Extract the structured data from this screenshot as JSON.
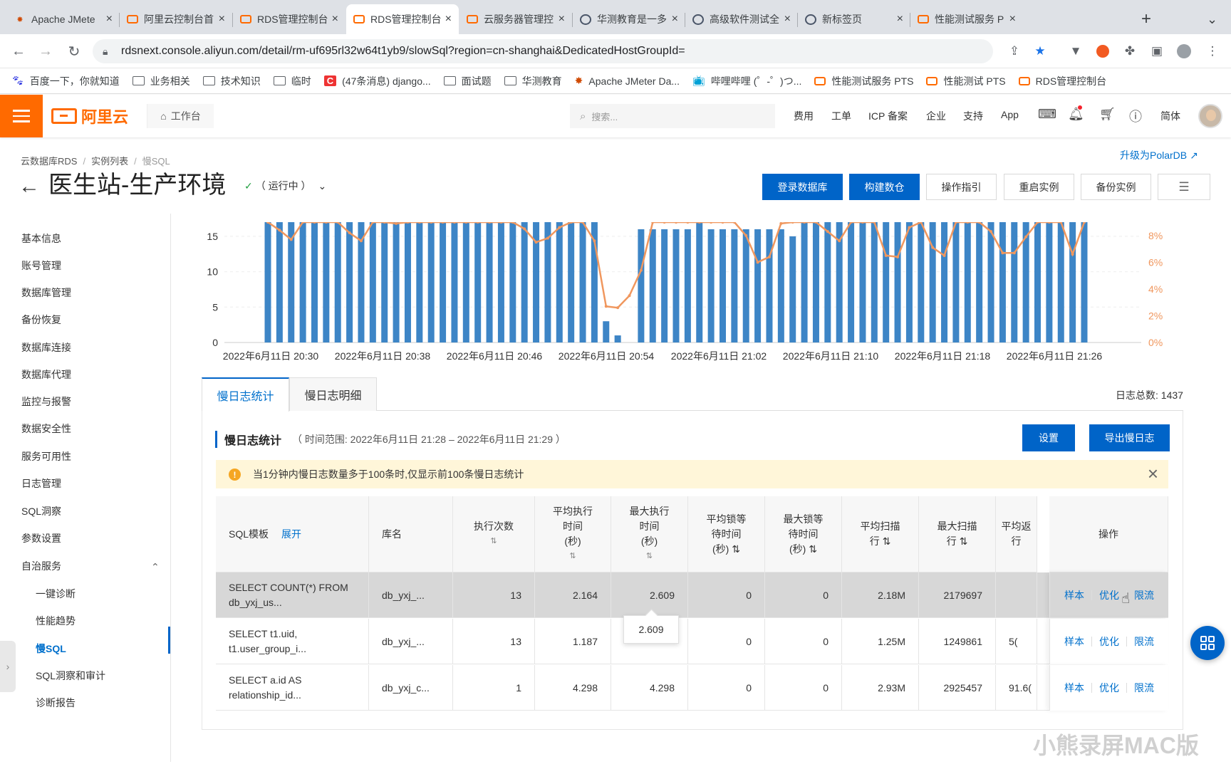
{
  "browser": {
    "tabs": [
      {
        "title": "Apache JMete",
        "icon": "jmeter-icon"
      },
      {
        "title": "阿里云控制台首",
        "icon": "aliyun-icon"
      },
      {
        "title": "RDS管理控制台",
        "icon": "aliyun-icon"
      },
      {
        "title": "RDS管理控制台",
        "icon": "aliyun-icon",
        "active": true
      },
      {
        "title": "云服务器管理控",
        "icon": "aliyun-icon"
      },
      {
        "title": "华测教育是一多",
        "icon": "globe-icon"
      },
      {
        "title": "高级软件测试全",
        "icon": "globe-icon"
      },
      {
        "title": "新标签页",
        "icon": "globe-icon"
      },
      {
        "title": "性能测试服务 P",
        "icon": "aliyun-icon"
      }
    ],
    "url": "rdsnext.console.aliyun.com/detail/rm-uf695rl32w64t1yb9/slowSql?region=cn-shanghai&DedicatedHostGroupId=",
    "bookmarks": [
      "百度一下，你就知道",
      "业务相关",
      "技术知识",
      "临时",
      "(47条消息) django...",
      "面试题",
      "华测教育",
      "Apache JMeter Da...",
      "哔哩哔哩 (゜-゜)つ...",
      "性能测试服务 PTS",
      "性能测试 PTS",
      "RDS管理控制台"
    ]
  },
  "console": {
    "logo": "阿里云",
    "workbench": "工作台",
    "search_placeholder": "搜索...",
    "nav": [
      "费用",
      "工单",
      "ICP 备案",
      "企业",
      "支持",
      "App"
    ],
    "lang": "简体"
  },
  "page": {
    "breadcrumb": [
      "云数据库RDS",
      "实例列表",
      "慢SQL"
    ],
    "title": "医生站-生产环境",
    "status": "（ 运行中 ）",
    "polardb": "升级为PolarDB",
    "buttons": [
      "登录数据库",
      "构建数仓",
      "操作指引",
      "重启实例",
      "备份实例"
    ]
  },
  "sidebar": {
    "items": [
      "基本信息",
      "账号管理",
      "数据库管理",
      "备份恢复",
      "数据库连接",
      "数据库代理",
      "监控与报警",
      "数据安全性",
      "服务可用性",
      "日志管理",
      "SQL洞察",
      "参数设置",
      "自治服务"
    ],
    "subitems": [
      "一键诊断",
      "性能趋势",
      "慢SQL",
      "SQL洞察和审计",
      "诊断报告"
    ]
  },
  "chart_data": {
    "type": "bar",
    "x_ticks": [
      "2022年6月11日 20:30",
      "2022年6月11日 20:38",
      "2022年6月11日 20:46",
      "2022年6月11日 20:54",
      "2022年6月11日 21:02",
      "2022年6月11日 21:10",
      "2022年6月11日 21:18",
      "2022年6月11日 21:26"
    ],
    "y_ticks_left": [
      "0",
      "5",
      "10",
      "15"
    ],
    "y_ticks_right": [
      "0%",
      "2%",
      "4%",
      "6%",
      "8%"
    ],
    "ylim_left": [
      0,
      17
    ],
    "ylim_right": [
      0,
      9
    ],
    "series": [
      {
        "type": "bar",
        "color": "#3d85c6",
        "values": [
          17,
          17,
          17,
          17,
          17,
          17,
          17,
          17,
          17,
          17,
          17,
          17,
          17,
          17,
          17,
          17,
          17,
          17,
          17,
          17,
          17,
          17,
          17,
          17,
          17,
          17,
          17,
          17,
          17,
          3,
          1,
          0,
          16,
          16,
          16,
          16,
          16,
          17,
          16,
          16,
          16,
          16,
          16,
          16,
          16,
          15,
          17,
          17,
          17,
          17,
          17,
          17,
          17,
          17,
          17,
          17,
          17,
          17,
          17,
          17,
          17,
          17,
          17,
          17,
          17,
          17,
          17,
          17,
          17,
          17,
          17
        ]
      },
      {
        "type": "line",
        "color": "#f0975e",
        "values": [
          9,
          8.4,
          7.7,
          9,
          9,
          9,
          9,
          8.2,
          7.6,
          9,
          9,
          8.9,
          9,
          9,
          9,
          9,
          9,
          9,
          9,
          9,
          9,
          9,
          8.5,
          7.5,
          7.8,
          8.6,
          9,
          9,
          7.6,
          2.7,
          2.6,
          3.5,
          5.4,
          9,
          9,
          9,
          9,
          9,
          9,
          9,
          9,
          8,
          6,
          6.4,
          8.9,
          9,
          9,
          9,
          8.3,
          7.6,
          9,
          9,
          9,
          6.5,
          6.4,
          8.6,
          9,
          7.1,
          6.5,
          9,
          9,
          9,
          8.3,
          6.7,
          6.7,
          7.9,
          9,
          9,
          9,
          6.6,
          9
        ]
      }
    ]
  },
  "content": {
    "tabs": [
      "慢日志统计",
      "慢日志明细"
    ],
    "log_total": "日志总数: 1437",
    "section_title": "慢日志统计",
    "time_range": "（ 时间范围: 2022年6月11日 21:28 – 2022年6月11日 21:29 ）",
    "btn_settings": "设置",
    "btn_export": "导出慢日志",
    "notice": "当1分钟内慢日志数量多于100条时,仅显示前100条慢日志统计"
  },
  "table": {
    "expand": "展开",
    "headers": [
      "SQL模板",
      "库名",
      "执行次数",
      "平均执行时间(秒)",
      "最大执行时间(秒)",
      "平均锁等待时间(秒)",
      "最大锁等待时间(秒)",
      "平均扫描行",
      "最大扫描行",
      "平均返回行",
      "操作"
    ],
    "rows": [
      {
        "sql": "SELECT COUNT(*) FROM db_yxj_us...",
        "db": "db_yxj_...",
        "count": "13",
        "avg_exec": "2.164",
        "max_exec": "2.609",
        "avg_lock": "0",
        "max_lock": "0",
        "avg_scan": "2.18M",
        "max_scan": "2179697",
        "avg_ret": ""
      },
      {
        "sql": "SELECT t1.uid, t1.user_group_i...",
        "db": "db_yxj_...",
        "count": "13",
        "avg_exec": "1.187",
        "max_exec": "",
        "avg_lock": "0",
        "max_lock": "0",
        "avg_scan": "1.25M",
        "max_scan": "1249861",
        "avg_ret": "5("
      },
      {
        "sql": "SELECT a.id AS relationship_id...",
        "db": "db_yxj_c...",
        "count": "1",
        "avg_exec": "4.298",
        "max_exec": "4.298",
        "avg_lock": "0",
        "max_lock": "0",
        "avg_scan": "2.93M",
        "max_scan": "2925457",
        "avg_ret": "91.6("
      }
    ],
    "ops": [
      "样本",
      "优化",
      "限流"
    ],
    "tooltip": "2.609"
  },
  "watermark": "小熊录屏MAC版"
}
